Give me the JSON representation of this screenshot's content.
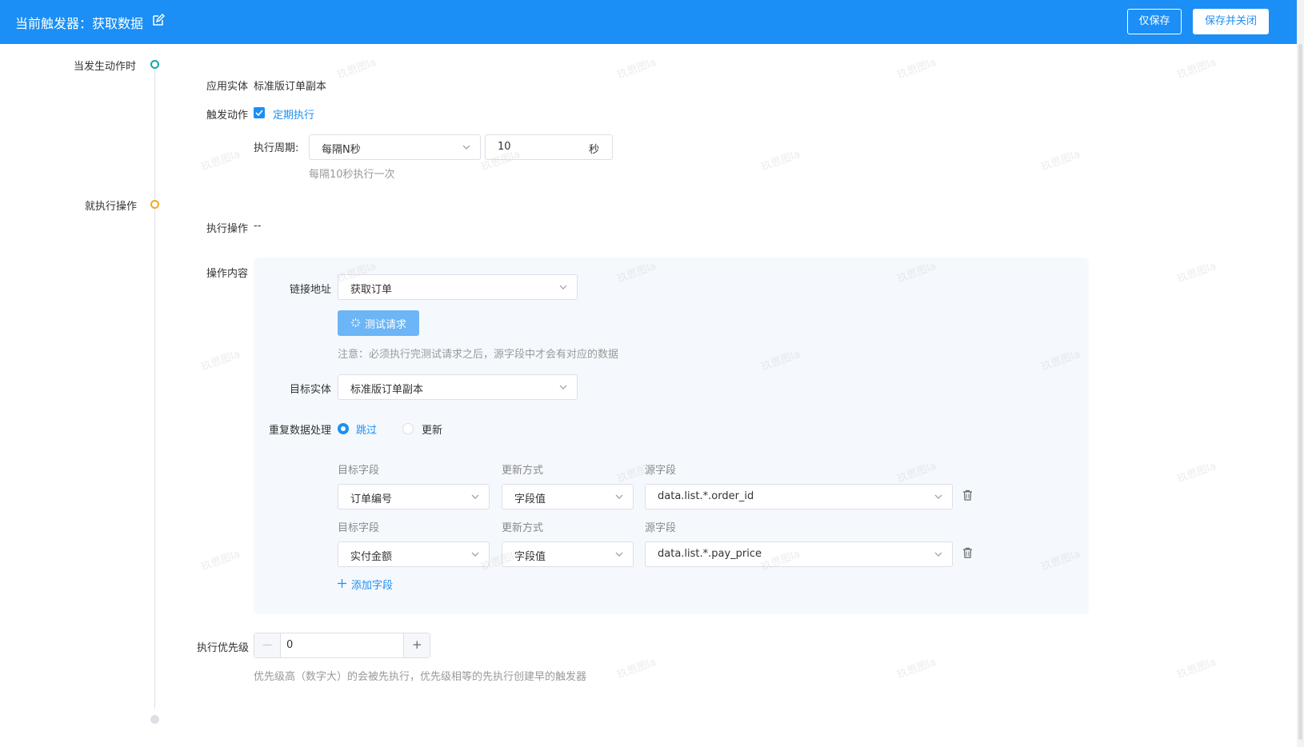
{
  "header": {
    "title": "当前触发器：获取数据",
    "save_only_label": "仅保存",
    "save_close_label": "保存并关闭"
  },
  "timeline": {
    "when_label": "当发生动作时",
    "then_label": "就执行操作"
  },
  "trigger": {
    "entity_label": "应用实体",
    "entity_value": "标准版订单副本",
    "action_label": "触发动作",
    "action_checkbox_label": "定期执行",
    "period_label": "执行周期:",
    "period_select": "每隔N秒",
    "period_number": "10",
    "period_unit": "秒",
    "period_hint": "每隔10秒执行一次"
  },
  "operation": {
    "exec_label": "执行操作",
    "exec_value": "--",
    "content_label": "操作内容",
    "link_label": "链接地址",
    "link_select": "获取订单",
    "test_button": "测试请求",
    "test_note": "注意：必须执行完测试请求之后，源字段中才会有对应的数据",
    "target_entity_label": "目标实体",
    "target_entity_select": "标准版订单副本",
    "dup_label": "重复数据处理",
    "dup_options": [
      "跳过",
      "更新"
    ],
    "col_target": "目标字段",
    "col_method": "更新方式",
    "col_source": "源字段",
    "rows": [
      {
        "target": "订单编号",
        "method": "字段值",
        "source": "data.list.*.order_id"
      },
      {
        "target": "实付金额",
        "method": "字段值",
        "source": "data.list.*.pay_price"
      }
    ],
    "add_field_label": "添加字段"
  },
  "priority": {
    "label": "执行优先级",
    "value": "0",
    "minus": "—",
    "plus": "+",
    "hint": "优先级高（数字大）的会被先执行，优先级相等的先执行创建早的触发器"
  },
  "watermark": "玖思图la",
  "colors": {
    "primary": "#1b8ff5",
    "panel_bg": "#f5f9fe",
    "timeline_start": "#13a8a8",
    "timeline_action": "#f5a623",
    "timeline_end": "#dcdfe6"
  }
}
